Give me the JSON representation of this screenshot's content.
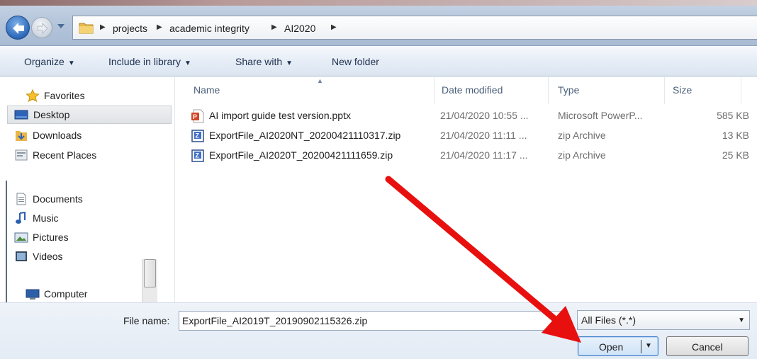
{
  "address_bar": {
    "back_icon": "back-arrow-icon",
    "forward_icon": "forward-arrow-icon",
    "breadcrumbs": [
      "projects",
      "academic integrity",
      "AI2020"
    ]
  },
  "toolbar": {
    "organize": "Organize",
    "include_in_library": "Include in library",
    "share_with": "Share with",
    "new_folder": "New folder"
  },
  "nav": {
    "favorites": "Favorites",
    "desktop": "Desktop",
    "downloads": "Downloads",
    "recent_places": "Recent Places",
    "documents": "Documents",
    "music": "Music",
    "pictures": "Pictures",
    "videos": "Videos",
    "computer": "Computer"
  },
  "columns": {
    "name": "Name",
    "date_modified": "Date modified",
    "type": "Type",
    "size": "Size"
  },
  "files": [
    {
      "name": "AI import guide test version.pptx",
      "date": "21/04/2020 10:55 ...",
      "type": "Microsoft PowerP...",
      "size": "585 KB",
      "icon": "powerpoint-icon"
    },
    {
      "name": "ExportFile_AI2020NT_20200421110317.zip",
      "date": "21/04/2020 11:11 ...",
      "type": "zip Archive",
      "size": "13 KB",
      "icon": "zip-icon"
    },
    {
      "name": "ExportFile_AI2020T_20200421111659.zip",
      "date": "21/04/2020 11:17 ...",
      "type": "zip Archive",
      "size": "25 KB",
      "icon": "zip-icon"
    }
  ],
  "bottom": {
    "file_name_label": "File name:",
    "file_name_value": "ExportFile_AI2019T_20190902115326.zip",
    "filter_value": "All Files (*.*)",
    "open_label": "Open",
    "cancel_label": "Cancel"
  },
  "colors": {
    "annotation_arrow": "#e8100f",
    "selection": "#cfe3f7"
  }
}
